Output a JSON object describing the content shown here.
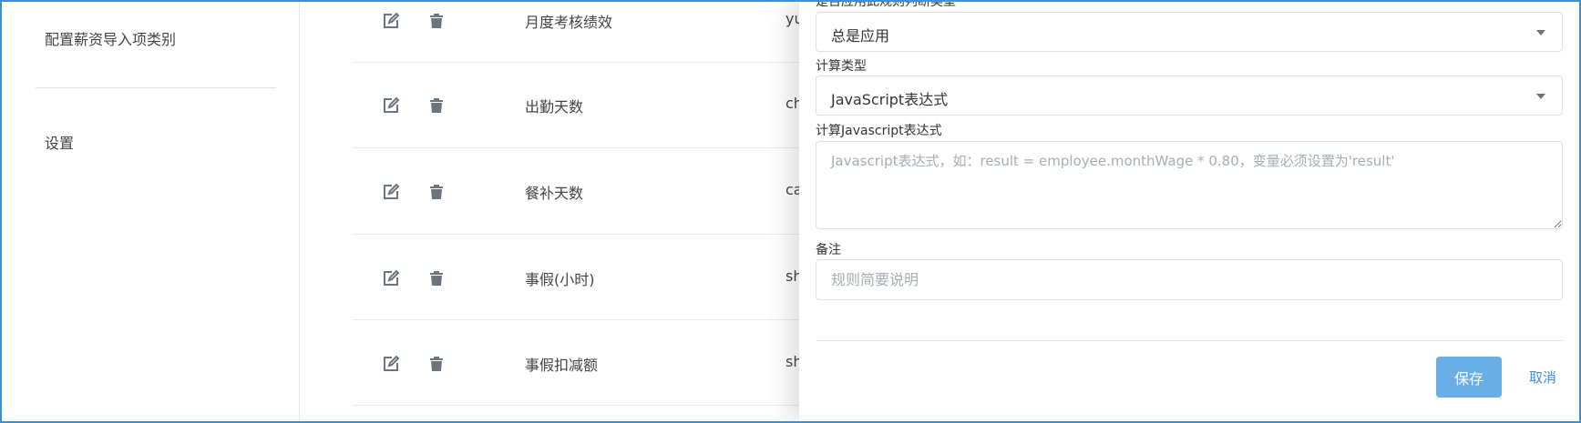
{
  "sidebar": {
    "items": [
      {
        "label": "配置薪资导入项类别"
      },
      {
        "label": "设置"
      }
    ]
  },
  "table": {
    "rows": [
      {
        "name": "月度考核绩效",
        "code": "yu"
      },
      {
        "name": "出勤天数",
        "code": "ch"
      },
      {
        "name": "餐补天数",
        "code": "ca"
      },
      {
        "name": "事假(小时)",
        "code": "sh"
      },
      {
        "name": "事假扣减额",
        "code": "sh"
      }
    ],
    "edit_icon": "edit-icon",
    "delete_icon": "trash-icon"
  },
  "drawer": {
    "top_label_partial": "是否应用此规则判断类型",
    "apply_select": {
      "value": "总是应用"
    },
    "calc_type": {
      "label": "计算类型",
      "value": "JavaScript表达式"
    },
    "expression": {
      "label": "计算Javascript表达式",
      "placeholder": "Javascript表达式，如：result = employee.monthWage * 0.80，变量必须设置为'result'"
    },
    "remark": {
      "label": "备注",
      "placeholder": "规则简要说明"
    },
    "save_label": "保存",
    "cancel_label": "取消"
  },
  "colors": {
    "primary": "#6aaee8",
    "link": "#3b8fd9",
    "frame": "#3d8fd8"
  }
}
